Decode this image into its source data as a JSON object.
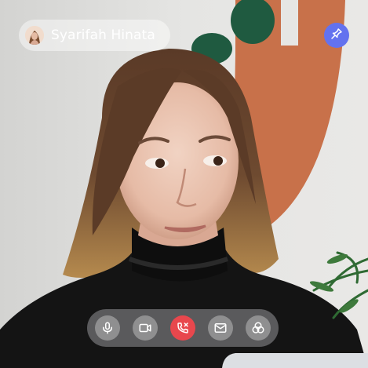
{
  "participant": {
    "name": "Syarifah Hinata"
  },
  "icons": {
    "avatar": "participant-avatar",
    "pin": "pin-icon",
    "microphone": "microphone-icon",
    "camera": "video-camera-icon",
    "end_call": "end-call-icon",
    "message": "message-icon",
    "effects": "effects-icon"
  },
  "colors": {
    "pin_button": "#6372ef",
    "end_call_button": "#e8474d",
    "icon_stroke": "#ffffff"
  }
}
